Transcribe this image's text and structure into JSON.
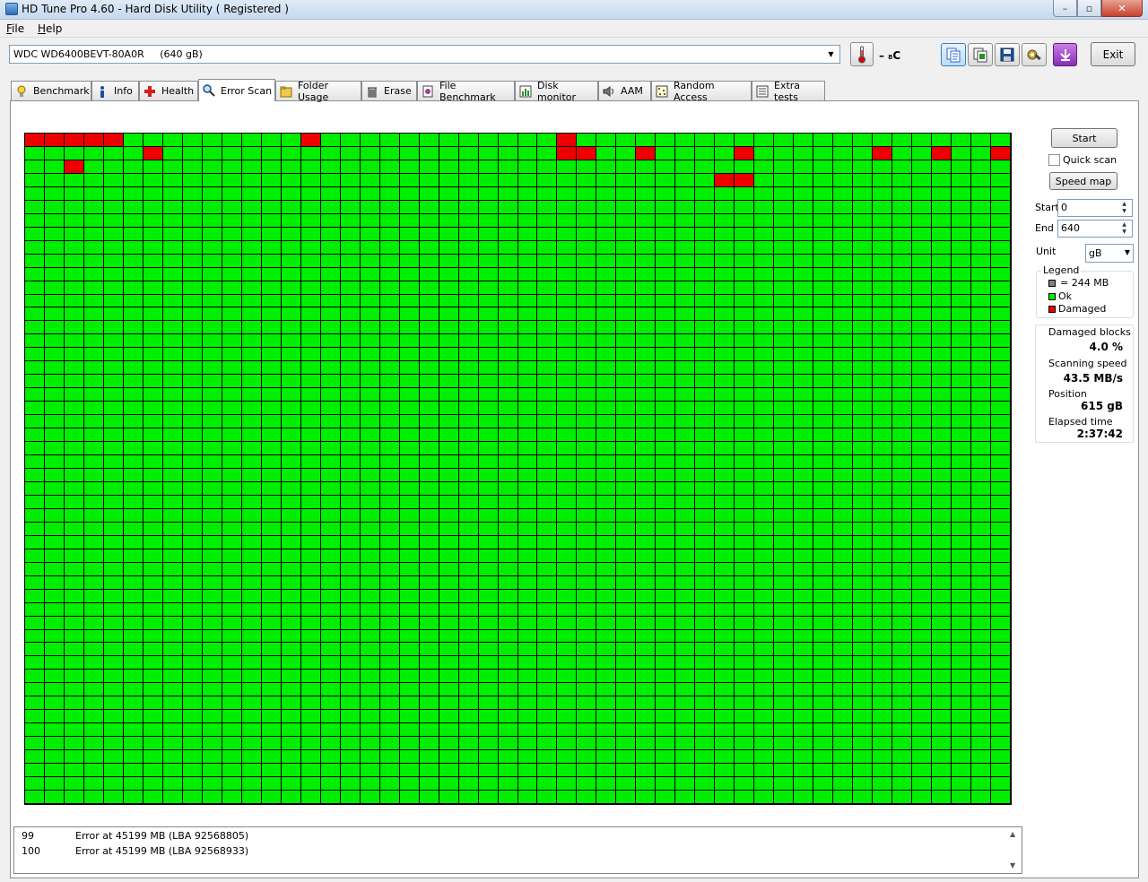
{
  "window": {
    "title": "HD Tune Pro 4.60 - Hard Disk Utility (  Registered )",
    "minimize_symbol": "–",
    "maximize_symbol": "▫",
    "close_symbol": "✕"
  },
  "menu": {
    "file_accel": "F",
    "file_rest": "ile",
    "help_accel": "H",
    "help_rest": "elp"
  },
  "toolbar": {
    "drive": "WDC WD6400BEVT-80A0R     (640 gB)",
    "temperature": "– ₈C",
    "exit_label": "Exit",
    "icons": [
      "copy-text-icon",
      "copy-image-icon",
      "save-icon",
      "options-icon",
      "download-icon"
    ]
  },
  "tabs": [
    {
      "label": "Benchmark",
      "icon": "bulb-icon"
    },
    {
      "label": "Info",
      "icon": "info-icon"
    },
    {
      "label": "Health",
      "icon": "health-cross-icon"
    },
    {
      "label": "Error Scan",
      "icon": "magnifier-icon",
      "active": true
    },
    {
      "label": "Folder Usage",
      "icon": "folder-icon"
    },
    {
      "label": "Erase",
      "icon": "trash-icon"
    },
    {
      "label": "File Benchmark",
      "icon": "file-benchmark-icon"
    },
    {
      "label": "Disk monitor",
      "icon": "disk-monitor-icon"
    },
    {
      "label": "AAM",
      "icon": "speaker-icon"
    },
    {
      "label": "Random Access",
      "icon": "random-access-icon"
    },
    {
      "label": "Extra tests",
      "icon": "extra-tests-icon"
    }
  ],
  "scan_map": {
    "columns": 50,
    "rows": 50,
    "colors": {
      "ok": "#00ee00",
      "damaged": "#ee0000",
      "pending": "#808080"
    },
    "scanned_blocks": 2517,
    "damaged_blocks": [
      [
        0,
        0
      ],
      [
        0,
        1
      ],
      [
        0,
        2
      ],
      [
        0,
        3
      ],
      [
        0,
        4
      ],
      [
        0,
        14
      ],
      [
        0,
        27
      ],
      [
        1,
        6
      ],
      [
        1,
        27
      ],
      [
        1,
        28
      ],
      [
        1,
        31
      ],
      [
        1,
        36
      ],
      [
        1,
        43
      ],
      [
        1,
        46
      ],
      [
        1,
        49
      ],
      [
        2,
        2
      ],
      [
        3,
        35
      ],
      [
        3,
        36
      ]
    ]
  },
  "controls": {
    "start_label": "Start",
    "quick_scan_label": "Quick scan",
    "quick_scan_checked": false,
    "speed_map_label": "Speed map",
    "start_field_label": "Start",
    "start_value": "0",
    "end_field_label": "End",
    "end_value": "640",
    "unit_label": "Unit",
    "unit_value": "gB"
  },
  "legend": {
    "title": "Legend",
    "block_size": "= 244 MB",
    "ok": "Ok",
    "damaged": "Damaged",
    "block_color": "#808080",
    "ok_color": "#00ee00",
    "damaged_color": "#ee0000"
  },
  "stats": {
    "damaged_blocks_label": "Damaged blocks",
    "damaged_blocks_value": "4.0 %",
    "scanning_speed_label": "Scanning speed",
    "scanning_speed_value": "43.5 MB/s",
    "position_label": "Position",
    "position_value": "615 gB",
    "elapsed_time_label": "Elapsed time",
    "elapsed_time_value": "2:37:42"
  },
  "log": [
    {
      "num": "99",
      "message": "Error at 45199 MB (LBA 92568805)"
    },
    {
      "num": "100",
      "message": "Error at 45199 MB (LBA 92568933)"
    }
  ]
}
